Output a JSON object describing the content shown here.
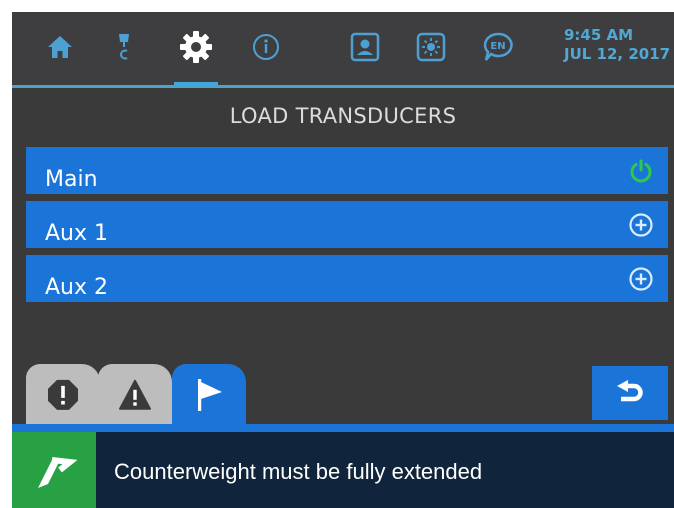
{
  "header": {
    "time": "9:45 AM",
    "date": "JUL 12, 2017",
    "language_badge": "EN",
    "accent_color": "#4aa6c4",
    "nav_icons": [
      "home-icon",
      "crane-hook-icon",
      "settings-gear-icon",
      "info-icon",
      "operator-profile-icon",
      "brightness-icon",
      "language-icon"
    ],
    "active_nav": "settings-gear-icon"
  },
  "page": {
    "title": "LOAD TRANSDUCERS"
  },
  "transducers": [
    {
      "label": "Main",
      "status_icon": "power-icon",
      "status_color": "#2ec84a"
    },
    {
      "label": "Aux 1",
      "status_icon": "plus-circle-icon"
    },
    {
      "label": "Aux 2",
      "status_icon": "plus-circle-icon"
    }
  ],
  "tabs": [
    {
      "icon": "stop-alert-icon",
      "active": false
    },
    {
      "icon": "warning-triangle-icon",
      "active": false
    },
    {
      "icon": "flag-icon",
      "active": true
    }
  ],
  "back_button_icon": "undo-arrow-icon",
  "status_bar": {
    "icon": "direction-arrow-icon",
    "message": "Counterweight must be fully extended",
    "badge_color": "#27a144"
  }
}
